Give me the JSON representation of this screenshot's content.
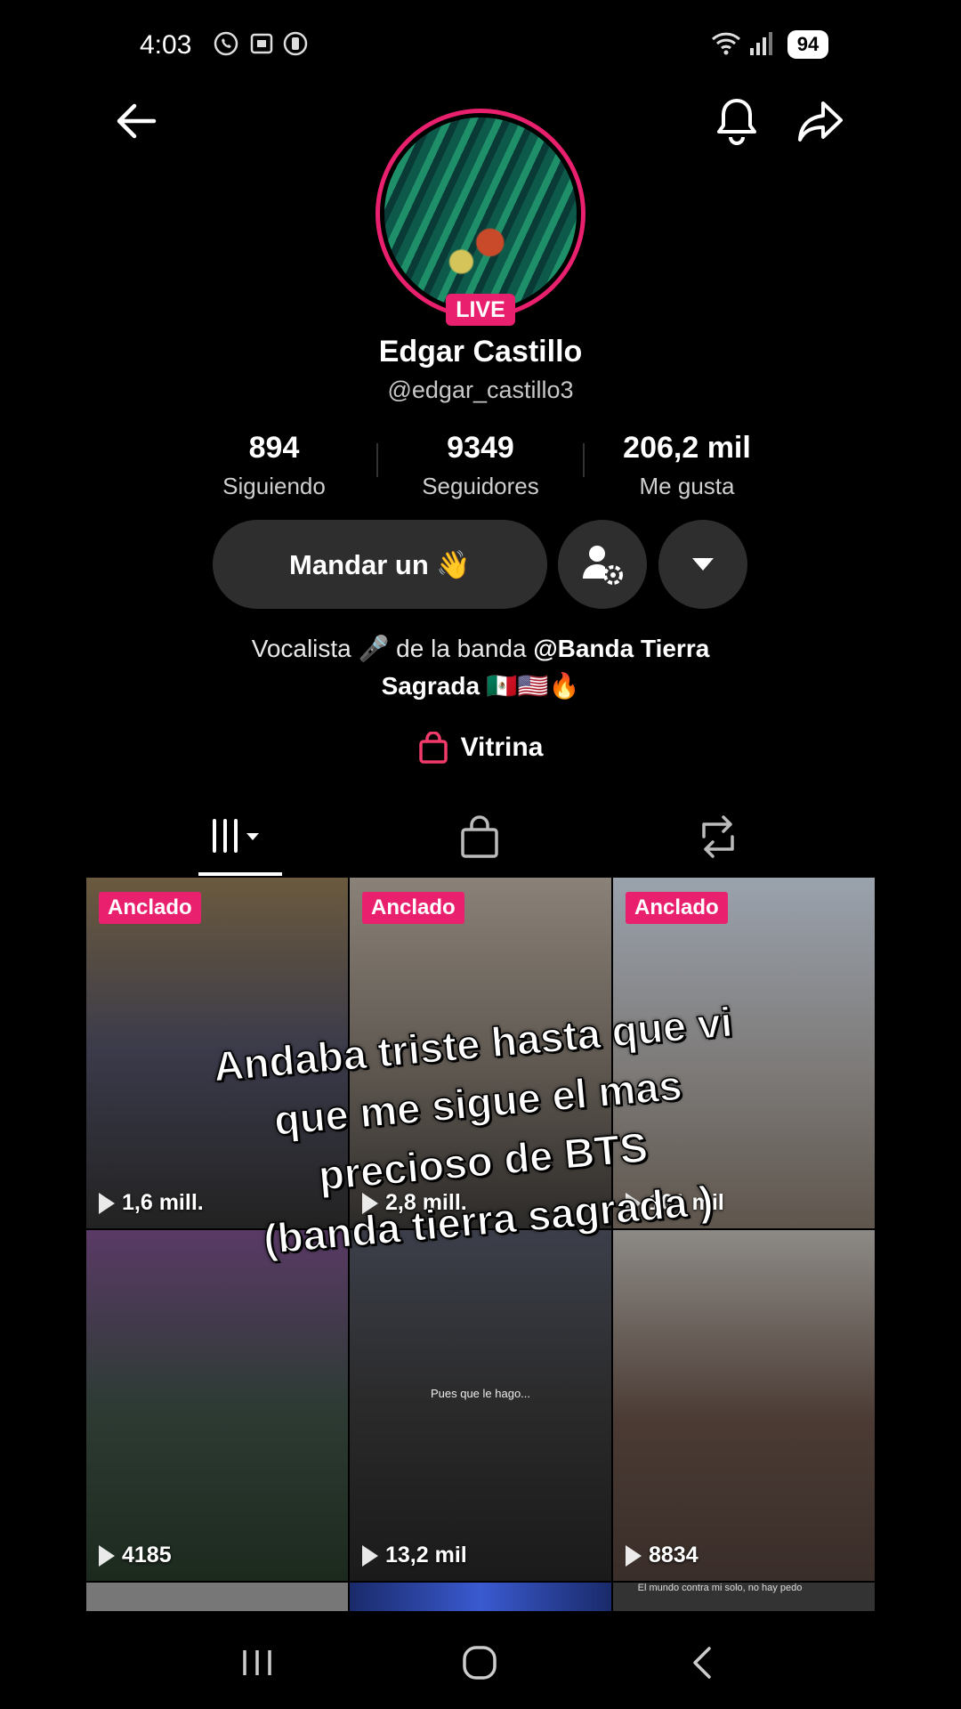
{
  "status": {
    "time": "4:03",
    "battery": "94"
  },
  "profile": {
    "live_badge": "LIVE",
    "name": "Edgar Castillo",
    "handle": "@edgar_castillo3",
    "stats": [
      {
        "value": "894",
        "label": "Siguiendo"
      },
      {
        "value": "9349",
        "label": "Seguidores"
      },
      {
        "value": "206,2 mil",
        "label": "Me gusta"
      }
    ],
    "message_button": "Mandar un 👋",
    "bio_prefix": "Vocalista 🎤 de la banda ",
    "bio_mention": "@Banda Tierra",
    "bio_line2_bold": "Sagrada",
    "bio_line2_emoji": " 🇲🇽🇺🇸🔥",
    "showcase": "Vitrina"
  },
  "videos": [
    {
      "pinned": "Anclado",
      "views": "1,6 mill.",
      "bg": "linear-gradient(180deg,#6b5a3e 0%,#3a3a4a 50%,#222 100%)"
    },
    {
      "pinned": "Anclado",
      "views": "2,8 mill.",
      "bg": "linear-gradient(180deg,#8a8278 0%,#5e5750 55%,#2c2a28 100%)"
    },
    {
      "pinned": "Anclado",
      "views": "101 mil",
      "bg": "linear-gradient(180deg,#9aa2ad 0%,#7d7a78 55%,#5f564d 100%)"
    },
    {
      "pinned": "",
      "views": "4185",
      "bg": "linear-gradient(180deg,#5a3a66 0%,#2d3b34 50%,#1c2a1e 100%)"
    },
    {
      "pinned": "",
      "views": "13,2 mil",
      "bg": "linear-gradient(180deg,#3c3f4a 0%,#2a2a2a 50%,#1a1a1a 100%)",
      "overlay": "Pues que le hago..."
    },
    {
      "pinned": "",
      "views": "8834",
      "bg": "linear-gradient(180deg,#8d8a86 0%,#4a3a33 55%,#3a2e2a 100%)"
    }
  ],
  "partial_row_text": "El mundo contra mi solo, no hay pedo",
  "caption_lines": [
    "Andaba triste hasta que vi",
    "que me sigue el mas",
    "precioso de BTS",
    "(banda tierra sagrada )"
  ]
}
